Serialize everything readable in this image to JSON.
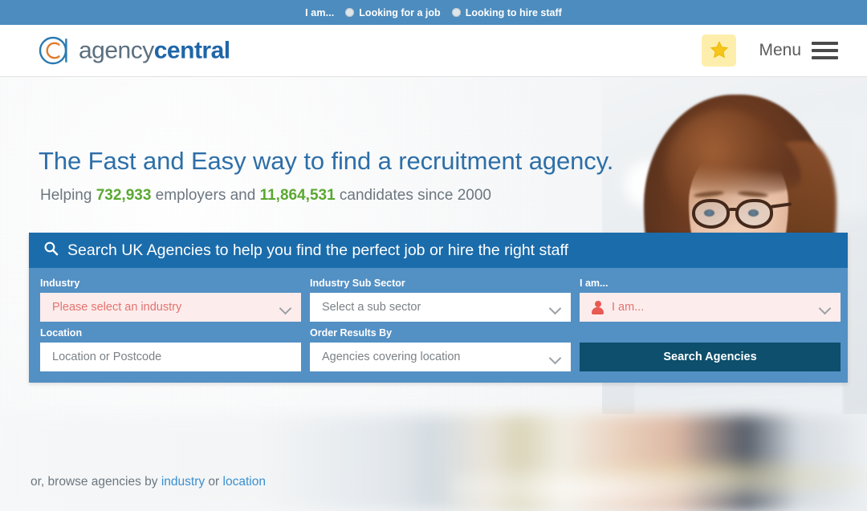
{
  "topbar": {
    "label": "I am...",
    "options": [
      {
        "text": "Looking for a job",
        "selected": false
      },
      {
        "text": "Looking to hire staff",
        "selected": false
      }
    ]
  },
  "header": {
    "logo": {
      "part1": "agency",
      "part2": "central",
      "icon": "agency-central-c-logo"
    },
    "favorites_icon": "star-icon",
    "menu_label": "Menu",
    "menu_icon": "hamburger-icon"
  },
  "hero": {
    "headline": "The Fast and Easy way to find a recruitment agency.",
    "sub_prefix": "Helping ",
    "employers_count": "732,933",
    "sub_mid": " employers and ",
    "candidates_count": "11,864,531",
    "sub_suffix": " candidates since 2000",
    "photo_alt": "smiling-woman-with-glasses-photo"
  },
  "search": {
    "header_icon": "search-icon",
    "header_text": "Search UK Agencies to help you find the perfect job or hire the right staff",
    "fields": {
      "industry": {
        "label": "Industry",
        "value": "Please select an industry",
        "state": "error",
        "icon": "chevron-down-icon"
      },
      "sub_sector": {
        "label": "Industry Sub Sector",
        "value": "Select a sub sector",
        "state": "normal",
        "icon": "chevron-down-icon"
      },
      "i_am": {
        "label": "I am...",
        "value": "I am...",
        "state": "error",
        "leading_icon": "person-icon",
        "icon": "chevron-down-icon"
      },
      "location": {
        "label": "Location",
        "value": "Location or Postcode",
        "state": "normal"
      },
      "order_by": {
        "label": "Order Results By",
        "value": "Agencies covering location",
        "state": "normal",
        "icon": "chevron-down-icon"
      }
    },
    "submit_label": "Search Agencies"
  },
  "browse": {
    "prefix": "or, browse agencies by ",
    "link1": "industry",
    "mid": " or ",
    "link2": "location"
  },
  "colors": {
    "topbar_blue": "#4d8cbe",
    "panel_header_blue": "#1b6cab",
    "panel_body_blue": "#5390c4",
    "button_dark_teal": "#0d4f6c",
    "headline_blue": "#2d6fa8",
    "count_green": "#5aa832",
    "error_pink_bg": "#fdecec",
    "error_red_text": "#e2736e",
    "link_blue": "#3a8fd0",
    "logo_blue": "#1f66a8",
    "logo_gray": "#5c6f7e",
    "star_yellow": "#f5c518",
    "star_bg": "#fdeeab"
  }
}
